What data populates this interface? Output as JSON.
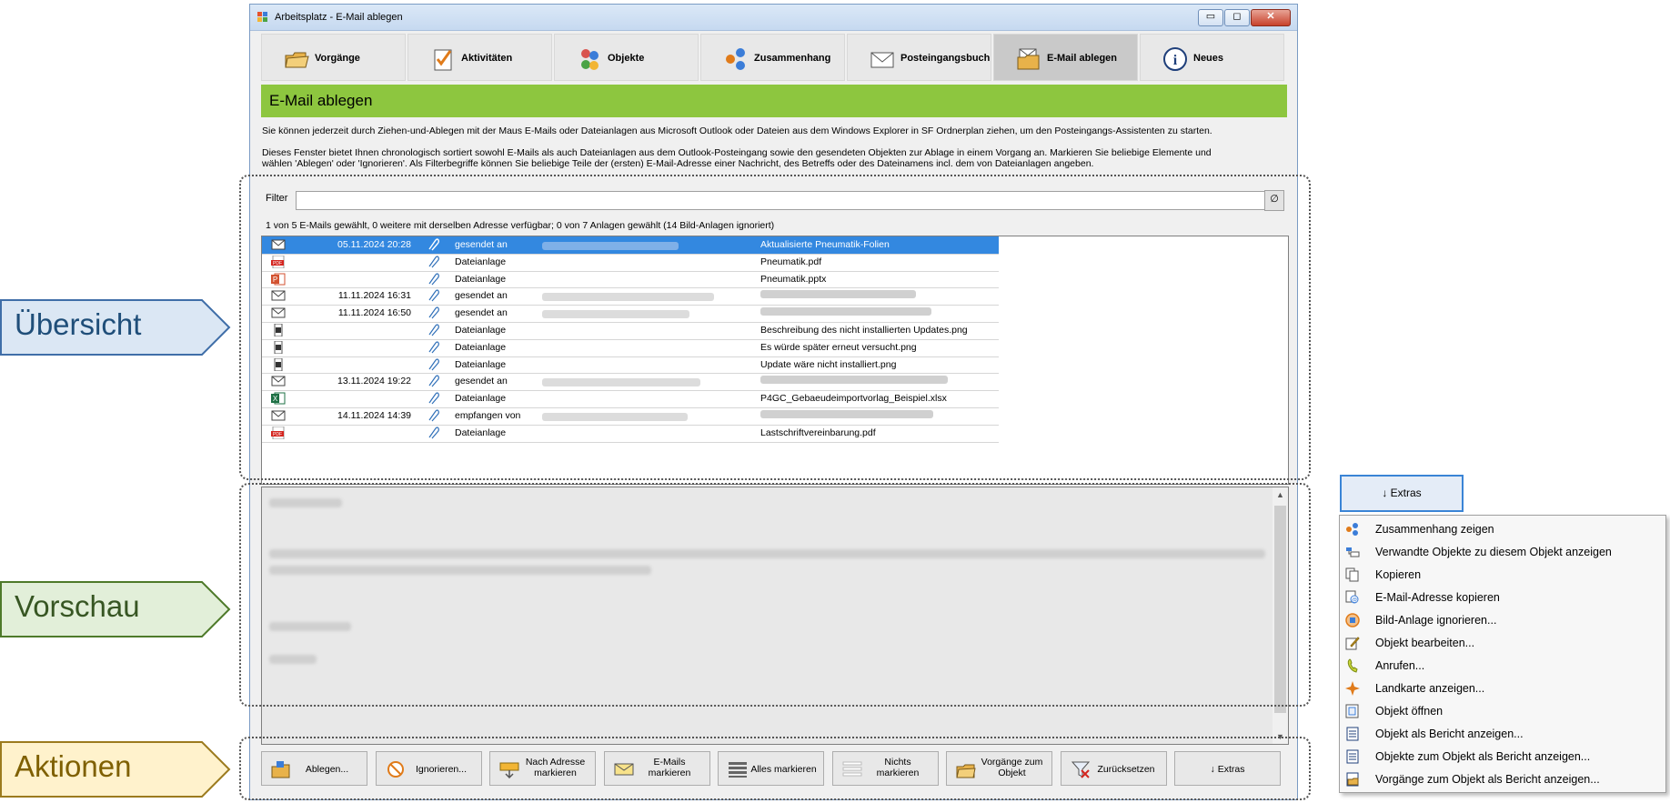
{
  "callouts": {
    "overview": "Übersicht",
    "preview": "Vorschau",
    "actions": "Aktionen",
    "overview_fill": "#dbe7f4",
    "overview_stroke": "#3f6ea8",
    "overview_text": "#1f4e79",
    "preview_fill": "#e2efd9",
    "preview_stroke": "#4e7a2a",
    "preview_text": "#375623",
    "actions_fill": "#fff2cc",
    "actions_stroke": "#9c7b1e",
    "actions_text": "#7f6000"
  },
  "window": {
    "title": "Arbeitsplatz - E-Mail ablegen",
    "minimize": "▭",
    "maximize": "◻",
    "close": "✕"
  },
  "tabs": [
    {
      "label": "Vorgänge",
      "icon": "folder-icon"
    },
    {
      "label": "Aktivitäten",
      "icon": "checklist-icon"
    },
    {
      "label": "Objekte",
      "icon": "objects-icon"
    },
    {
      "label": "Zusammenhang",
      "icon": "relation-icon"
    },
    {
      "label": "Posteingangsbuch",
      "icon": "envelope-icon"
    },
    {
      "label": "E-Mail ablegen",
      "icon": "mail-folder-icon",
      "active": true
    },
    {
      "label": "Neues",
      "icon": "info-icon"
    }
  ],
  "header": {
    "title": "E-Mail ablegen",
    "accent": "#8dc63f"
  },
  "description": {
    "line1": "Sie können jederzeit durch Ziehen-und-Ablegen mit der Maus E-Mails oder Dateianlagen aus Microsoft Outlook oder Dateien aus dem Windows Explorer in SF Ordnerplan ziehen, um den Posteingangs-Assistenten zu starten.",
    "line2": "Dieses Fenster bietet Ihnen chronologisch sortiert sowohl E-Mails als auch Dateianlagen aus dem Outlook-Posteingang sowie den gesendeten Objekten zur Ablage in einem Vorgang an. Markieren Sie beliebige Elemente und",
    "line3": "wählen 'Ablegen' oder 'Ignorieren'. Als Filterbegriffe können Sie beliebige Teile der (ersten) E-Mail-Adresse einer Nachricht, des Betreffs oder des Dateinamens incl. dem von Dateianlagen angeben."
  },
  "filter": {
    "label": "Filter",
    "value": "",
    "clear_label": "∅"
  },
  "status": "1 von 5 E-Mails gewählt, 0 weitere mit derselben Adresse verfügbar; 0 von 7 Anlagen gewählt (14 Bild-Anlagen ignoriert)",
  "rows": [
    {
      "icon": "mail-icon",
      "date": "05.11.2024 20:28",
      "type": "gesendet an",
      "party": true,
      "subject": "Aktualisierte Pneumatik-Folien",
      "selected": true
    },
    {
      "icon": "pdf-icon",
      "date": "",
      "type": "Dateianlage",
      "party": false,
      "subject": "Pneumatik.pdf"
    },
    {
      "icon": "pptx-icon",
      "date": "",
      "type": "Dateianlage",
      "party": false,
      "subject": "Pneumatik.pptx"
    },
    {
      "icon": "mail-icon",
      "date": "11.11.2024 16:31",
      "type": "gesendet an",
      "party": true,
      "subject": ""
    },
    {
      "icon": "mail-icon",
      "date": "11.11.2024 16:50",
      "type": "gesendet an",
      "party": true,
      "subject": ""
    },
    {
      "icon": "image-icon",
      "date": "",
      "type": "Dateianlage",
      "party": false,
      "subject": "Beschreibung des nicht installierten Updates.png"
    },
    {
      "icon": "image-icon",
      "date": "",
      "type": "Dateianlage",
      "party": false,
      "subject": "Es würde später erneut versucht.png"
    },
    {
      "icon": "image-icon",
      "date": "",
      "type": "Dateianlage",
      "party": false,
      "subject": "Update wäre nicht installiert.png"
    },
    {
      "icon": "mail-icon",
      "date": "13.11.2024 19:22",
      "type": "gesendet an",
      "party": true,
      "subject": ""
    },
    {
      "icon": "xlsx-icon",
      "date": "",
      "type": "Dateianlage",
      "party": false,
      "subject": "P4GC_Gebaeudeimportvorlag_Beispiel.xlsx"
    },
    {
      "icon": "mail-icon",
      "date": "14.11.2024 14:39",
      "type": "empfangen von",
      "party": true,
      "subject": ""
    },
    {
      "icon": "pdf-icon",
      "date": "",
      "type": "Dateianlage",
      "party": false,
      "subject": "Lastschriftvereinbarung.pdf"
    }
  ],
  "actions": [
    {
      "label": "Ablegen...",
      "icon": "file-icon"
    },
    {
      "label": "Ignorieren...",
      "icon": "ignore-icon"
    },
    {
      "label": "Nach Adresse\nmarkieren",
      "icon": "mark-address-icon"
    },
    {
      "label": "E-Mails\nmarkieren",
      "icon": "mark-mails-icon"
    },
    {
      "label": "Alles markieren",
      "icon": "select-all-icon"
    },
    {
      "label": "Nichts\nmarkieren",
      "icon": "select-none-icon"
    },
    {
      "label": "Vorgänge zum\nObjekt",
      "icon": "cases-icon"
    },
    {
      "label": "Zurücksetzen",
      "icon": "reset-icon"
    },
    {
      "label": "↓ Extras",
      "icon": ""
    }
  ],
  "extras": {
    "button_label": "↓ Extras",
    "items": [
      {
        "label": "Zusammenhang zeigen",
        "icon": "relation-icon"
      },
      {
        "label": "Verwandte Objekte zu diesem Objekt anzeigen",
        "icon": "related-icon"
      },
      {
        "label": "Kopieren",
        "icon": "copy-icon"
      },
      {
        "label": "E-Mail-Adresse kopieren",
        "icon": "copy-address-icon"
      },
      {
        "label": "Bild-Anlage ignorieren...",
        "icon": "ignore-image-icon"
      },
      {
        "label": "Objekt bearbeiten...",
        "icon": "edit-icon"
      },
      {
        "label": "Anrufen...",
        "icon": "phone-icon"
      },
      {
        "label": "Landkarte anzeigen...",
        "icon": "map-icon"
      },
      {
        "label": "Objekt öffnen",
        "icon": "open-icon"
      },
      {
        "label": "Objekt als Bericht anzeigen...",
        "icon": "report-icon"
      },
      {
        "label": "Objekte zum Objekt als Bericht anzeigen...",
        "icon": "report-objects-icon"
      },
      {
        "label": "Vorgänge zum Objekt als Bericht anzeigen...",
        "icon": "report-cases-icon"
      }
    ]
  }
}
